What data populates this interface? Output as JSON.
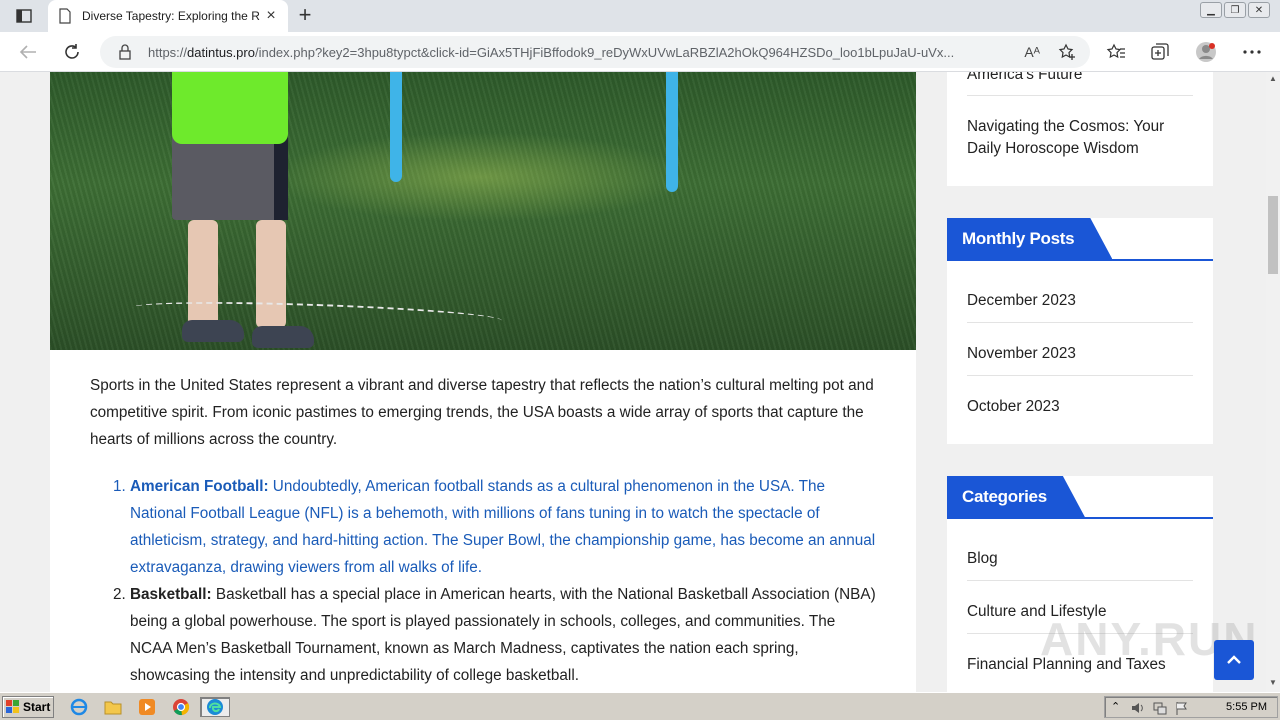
{
  "browser": {
    "tab_title": "Diverse Tapestry: Exploring the Ri",
    "url_prefix": "https://",
    "url_domain": "datintus.pro",
    "url_rest": "/index.php?key2=3hpu8typct&click-id=GiAx5THjFiBffodok9_reDyWxUVwLaRBZlA2hOkQ964HZSDo_loo1bLpuJaU-uVx...",
    "read_aloud_glyph": "Aᴬ"
  },
  "article": {
    "intro": "Sports in the United States represent a vibrant and diverse tapestry that reflects the nation’s cultural melting pot and competitive spirit. From iconic pastimes to emerging trends, the USA boasts a wide array of sports that capture the hearts of millions across the country.",
    "items": [
      {
        "lead": "American Football:",
        "text": " Undoubtedly, American football stands as a cultural phenomenon in the USA. The National Football League (NFL) is a behemoth, with millions of fans tuning in to watch the spectacle of athleticism, strategy, and hard-hitting action. The Super Bowl, the championship game, has become an annual extravaganza, drawing viewers from all walks of life."
      },
      {
        "lead": "Basketball:",
        "text": " Basketball has a special place in American hearts, with the National Basketball Association (NBA) being a global powerhouse. The sport is played passionately in schools, colleges, and communities. The NCAA Men’s Basketball Tournament, known as March Madness, captivates the nation each spring, showcasing the intensity and unpredictability of college basketball."
      }
    ]
  },
  "sidebar": {
    "recent_links": [
      "America’s Future",
      "Navigating the Cosmos: Your Daily Horoscope Wisdom"
    ],
    "monthly": {
      "title": "Monthly Posts",
      "items": [
        "December 2023",
        "November 2023",
        "October 2023"
      ]
    },
    "categories": {
      "title": "Categories",
      "items": [
        "Blog",
        "Culture and Lifestyle",
        "Financial Planning and Taxes"
      ]
    }
  },
  "watermark": "ANY.RUN",
  "taskbar": {
    "start_label": "Start",
    "clock": "5:55 PM"
  },
  "colors": {
    "accent": "#1a56d6",
    "link": "#1a5bb8"
  }
}
